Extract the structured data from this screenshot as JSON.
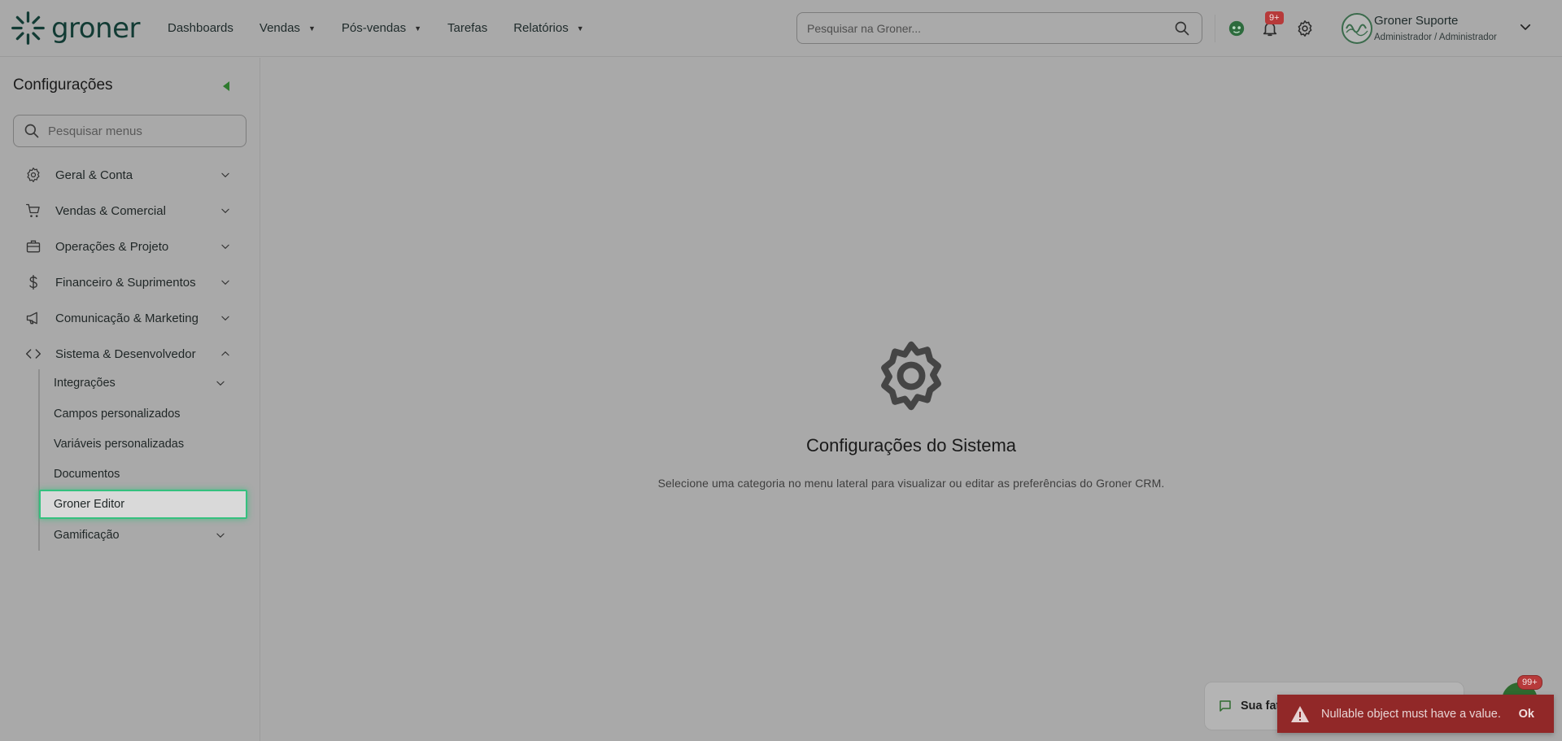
{
  "header": {
    "logo_text": "groner",
    "nav": [
      {
        "label": "Dashboards",
        "has_caret": false
      },
      {
        "label": "Vendas",
        "has_caret": true
      },
      {
        "label": "Pós-vendas",
        "has_caret": true
      },
      {
        "label": "Tarefas",
        "has_caret": false
      },
      {
        "label": "Relatórios",
        "has_caret": true
      }
    ],
    "search_placeholder": "Pesquisar na Groner...",
    "notification_badge": "9+",
    "user": {
      "name": "Groner Suporte",
      "role": "Administrador / Administrador"
    }
  },
  "sidebar": {
    "title": "Configurações",
    "search_placeholder": "Pesquisar menus",
    "items": [
      {
        "label": "Geral & Conta",
        "icon": "gear-icon",
        "expanded": false
      },
      {
        "label": "Vendas & Comercial",
        "icon": "cart-icon",
        "expanded": false
      },
      {
        "label": "Operações & Projeto",
        "icon": "briefcase-icon",
        "expanded": false
      },
      {
        "label": "Financeiro & Suprimentos",
        "icon": "dollar-icon",
        "expanded": false
      },
      {
        "label": "Comunicação & Marketing",
        "icon": "megaphone-icon",
        "expanded": false
      },
      {
        "label": "Sistema & Desenvolvedor",
        "icon": "code-icon",
        "expanded": true
      }
    ],
    "subitems": [
      {
        "label": "Integrações",
        "has_chevron": true
      },
      {
        "label": "Campos personalizados",
        "has_chevron": false
      },
      {
        "label": "Variáveis personalizadas",
        "has_chevron": false
      },
      {
        "label": "Documentos",
        "has_chevron": false
      },
      {
        "label": "Groner Editor",
        "has_chevron": false,
        "active": true
      },
      {
        "label": "Gamificação",
        "has_chevron": true
      }
    ]
  },
  "main": {
    "title": "Configurações do Sistema",
    "subtitle": "Selecione uma categoria no menu lateral para visualizar ou editar as preferências do Groner CRM."
  },
  "chat": {
    "text": "Sua fat",
    "fab_badge": "99+"
  },
  "toast": {
    "message": "Nullable object must have a value.",
    "ok_label": "Ok"
  },
  "colors": {
    "accent_green": "#35c07e",
    "error_red": "#912828",
    "badge_red": "#b73a3a"
  }
}
